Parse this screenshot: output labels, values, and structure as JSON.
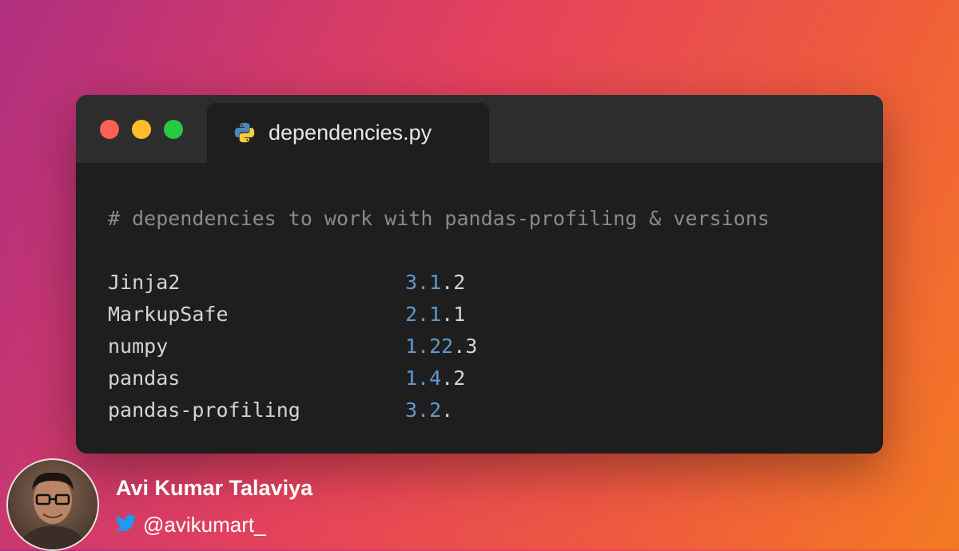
{
  "window": {
    "tab": {
      "filename": "dependencies.py",
      "icon": "python-icon"
    },
    "traffic_lights": {
      "red": "#ff5f57",
      "yellow": "#febc2e",
      "green": "#28c840"
    }
  },
  "code": {
    "comment": "# dependencies to work with pandas-profiling & versions",
    "packages": [
      {
        "name": "Jinja2",
        "version_highlight": "3.1",
        "version_rest": ".2"
      },
      {
        "name": "MarkupSafe",
        "version_highlight": "2.1",
        "version_rest": ".1"
      },
      {
        "name": "numpy",
        "version_highlight": "1.22",
        "version_rest": ".3"
      },
      {
        "name": "pandas",
        "version_highlight": "1.4",
        "version_rest": ".2"
      },
      {
        "name": "pandas-profiling",
        "version_highlight": "3.2",
        "version_rest": "."
      }
    ]
  },
  "author": {
    "name": "Avi Kumar Talaviya",
    "handle": "@avikumart_",
    "handle_icon": "twitter-icon"
  }
}
